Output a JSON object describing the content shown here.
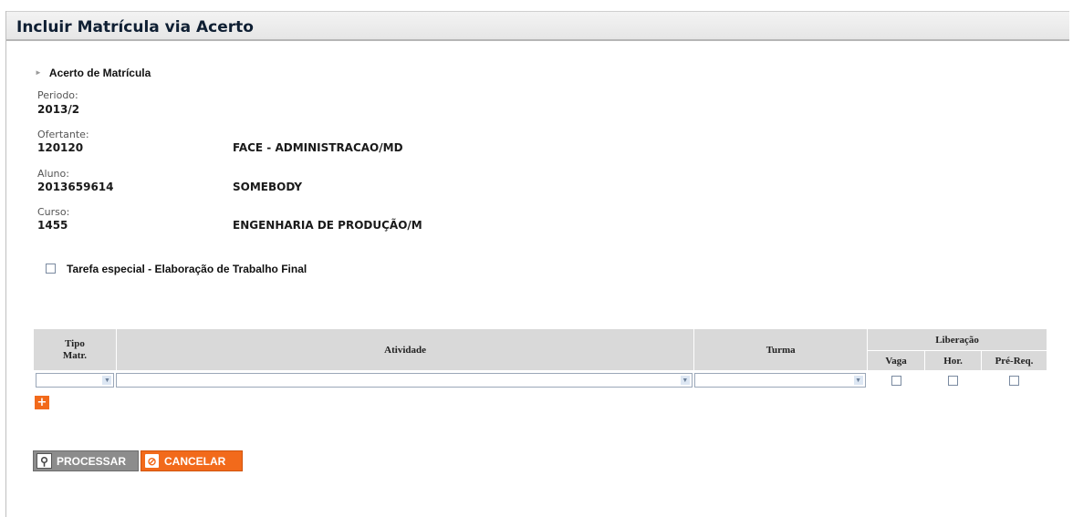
{
  "page": {
    "title": "Incluir Matrícula via Acerto"
  },
  "section": {
    "title": "Acerto de Matrícula"
  },
  "fields": {
    "periodo": {
      "label": "Periodo:",
      "value": "2013/2"
    },
    "ofertante": {
      "label": "Ofertante:",
      "code": "120120",
      "name": "FACE - ADMINISTRACAO/MD"
    },
    "aluno": {
      "label": "Aluno:",
      "code": "2013659614",
      "name": "SOMEBODY"
    },
    "curso": {
      "label": "Curso:",
      "code": "1455",
      "name": "ENGENHARIA DE PRODUÇÃO/M"
    }
  },
  "special_task": {
    "label": "Tarefa especial - Elaboração de Trabalho Final",
    "checked": false
  },
  "table": {
    "headers": {
      "tipo_line1": "Tipo",
      "tipo_line2": "Matr.",
      "atividade": "Atividade",
      "turma": "Turma",
      "liberacao": "Liberação",
      "vaga": "Vaga",
      "hor": "Hor.",
      "prereq": "Pré-Req."
    },
    "row": {
      "tipo": "",
      "atividade": "",
      "turma": "",
      "vaga": false,
      "hor": false,
      "prereq": false
    }
  },
  "actions": {
    "add": "+",
    "processar": "PROCESSAR",
    "cancelar": "CANCELAR"
  },
  "colors": {
    "accent": "#f26a1b",
    "header_bg": "#d9d9d9",
    "button_gray": "#8c8c8c"
  },
  "icons": {
    "section": "triangle-right-icon",
    "processar": "search-key-icon",
    "cancelar": "prohibited-icon",
    "dropdown": "chevron-down-icon"
  }
}
